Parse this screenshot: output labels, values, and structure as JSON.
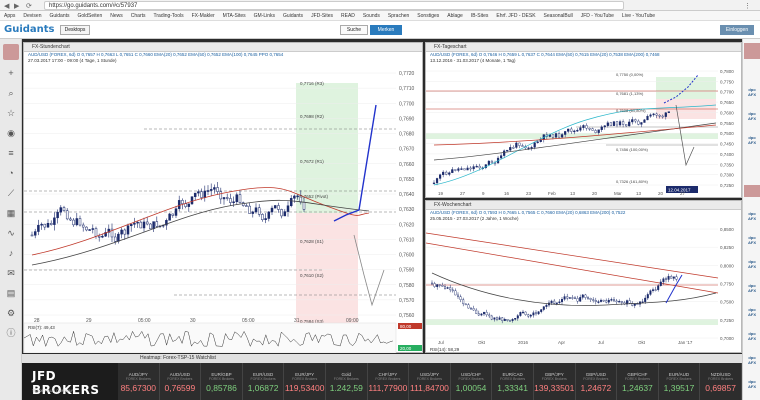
{
  "browser": {
    "url": "https://go.guidants.com/#c/57937",
    "bookmarks": [
      "Apps",
      "Devisen",
      "Guidants",
      "GoldSeiten",
      "News",
      "Charts",
      "Trading-Tools",
      "FX-Makler",
      "MTA-Sites",
      "GM-Links",
      "Guidants",
      "JFD-Sites",
      "READ",
      "Sounds",
      "Sprachen",
      "Sonstiges",
      "Ablage",
      "IB-Sites",
      "Ehrf. JFD - DESK",
      "SeasonalBull",
      "JFD - YouTube",
      "Live - YouTube"
    ]
  },
  "header": {
    "logo": "Guidants",
    "desktop_button": "Desktops",
    "search_button": "Suche",
    "bookmark_button": "Merken",
    "login_button": "Einloggen"
  },
  "panel_left": {
    "title": "FX-Stundenchart",
    "info": "AUD/USD (FOREX, 6d) O 0,7657 H 0,7663 L 0,7651 C 0,7660 EMA(20) 0,7652 EMA(50) 0,7652 EMA(100) 0,7645 PPO 0,7654",
    "period": "27.03.2017 17:00 - 09:00 (4 Tage, 1 Stunde)",
    "y_labels": [
      "0,7720",
      "0,7710",
      "0,7700",
      "0,7690",
      "0,7680",
      "0,7670",
      "0,7660",
      "0,7650",
      "0,7640",
      "0,7630",
      "0,7620",
      "0,7610",
      "0,7600",
      "0,7590",
      "0,7580",
      "0,7570",
      "0,7560"
    ],
    "fib_labels": [
      "0,7716 (R3)",
      "0,7698 (R2)",
      "0,7672 (R1)",
      "0,7652 (Pivot)",
      "0,7628 (S1)",
      "0,7610 (S2)",
      "0,7584 (S3)"
    ],
    "x_labels": [
      "28",
      "29",
      "05:00",
      "30",
      "05:00",
      "31",
      "09:00"
    ],
    "rsi_label": "RSI(7): 49,43",
    "rsi_values": [
      "80,00",
      "20,00"
    ]
  },
  "panel_tr": {
    "title": "FX-Tageschart",
    "info": "AUD/USD (FOREX, 6d) O 0,7646 H 0,7659 L 0,7637 C 0,7644 EMA(50) 0,7615 EMA(20) 0,7538 EMA(200) 0,7468",
    "period": "13.12.2016 - 31.03.2017 (4 Monate, 1 Tag)",
    "y_labels": [
      "0,7800",
      "0,7750",
      "0,7700",
      "0,7650",
      "0,7600",
      "0,7550",
      "0,7500",
      "0,7450",
      "0,7400",
      "0,7350",
      "0,7300",
      "0,7250"
    ],
    "fib_labels": [
      "0,7750 (0,00%)",
      "0,7681 (1,13%)",
      "0,7608 (61,80%)",
      "0,7456 (100,00%)",
      "0,7326 (161,80%)"
    ],
    "date_flag": "12.04.2017",
    "x_labels": [
      "19",
      "27",
      "9",
      "16",
      "23",
      "Feb",
      "13",
      "20",
      "Mar",
      "13",
      "20",
      "27"
    ]
  },
  "panel_br": {
    "title": "FX-Wochenchart",
    "info": "AUD/USD (FOREX, 6d) O 0,7593 H 0,7665 L 0,7565 C 0,7660 EMA(20) 0,6863 EMA(200) 0,7522",
    "period": "25.05.2015 - 27.03.2017 (2 Jahre, 1 Woche)",
    "y_labels": [
      "0,8500",
      "0,8250",
      "0,8000",
      "0,7750",
      "0,7500",
      "0,7250",
      "0,7000"
    ],
    "x_labels": [
      "Jul",
      "Okt",
      "2016",
      "Apr",
      "Jul",
      "Okt",
      "Jan '17"
    ],
    "rsi_label": "RSI(14): 58,29"
  },
  "heatmap_title": "Heatmap: Forex-TSP-15 Watchlist",
  "broker": {
    "name": "JFD BROKERS",
    "tagline": "TRADE YOUR OWN WAY"
  },
  "quotes": [
    {
      "name": "AUD/JPY",
      "sub": "FOREX Brokers",
      "value": "85,67300",
      "dir": "dn"
    },
    {
      "name": "AUD/USD",
      "sub": "FOREX Brokers",
      "value": "0,76599",
      "dir": "dn"
    },
    {
      "name": "EUR/GBP",
      "sub": "FOREX Brokers",
      "value": "0,85786",
      "dir": "up"
    },
    {
      "name": "EUR/USD",
      "sub": "FOREX Brokers",
      "value": "1,06872",
      "dir": "up"
    },
    {
      "name": "EUR/JPY",
      "sub": "FOREX Brokers",
      "value": "119,53400",
      "dir": "dn"
    },
    {
      "name": "Gold",
      "sub": "FOREX Brokers",
      "value": "1.242,59",
      "dir": "up"
    },
    {
      "name": "CHF/JPY",
      "sub": "FOREX Brokers",
      "value": "111,77900",
      "dir": "dn"
    },
    {
      "name": "USD/JPY",
      "sub": "FOREX Brokers",
      "value": "111,84700",
      "dir": "dn"
    },
    {
      "name": "USD/CHF",
      "sub": "FOREX Brokers",
      "value": "1,00054",
      "dir": "up"
    },
    {
      "name": "EUR/CAD",
      "sub": "FOREX Brokers",
      "value": "1,33341",
      "dir": "up"
    },
    {
      "name": "GBP/JPY",
      "sub": "FOREX Brokers",
      "value": "139,33501",
      "dir": "dn"
    },
    {
      "name": "GBP/USD",
      "sub": "FOREX Brokers",
      "value": "1,24672",
      "dir": "dn"
    },
    {
      "name": "GBP/CHF",
      "sub": "FOREX Brokers",
      "value": "1,24637",
      "dir": "up"
    },
    {
      "name": "EUR/AUD",
      "sub": "FOREX Brokers",
      "value": "1,39517",
      "dir": "up"
    },
    {
      "name": "NZD/USD",
      "sub": "FOREX Brokers",
      "value": "0,69857",
      "dir": "dn"
    }
  ]
}
